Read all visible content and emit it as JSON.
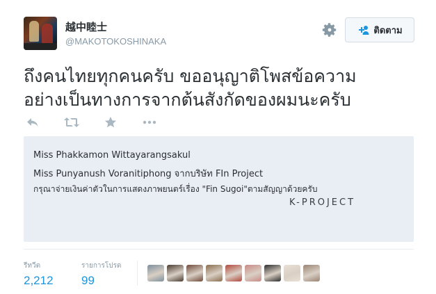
{
  "user": {
    "display_name": "越中睦士",
    "handle": "@MAKOTOKOSHINAKA"
  },
  "follow_button": {
    "label": "ติดตาม"
  },
  "tweet": {
    "line1": "ถึงคนไทยทุกคนครับ ขออนุญาติโพสข้อความ",
    "line2": "อย่างเป็นทางการจากต้นสังกัดของผมนะครับ"
  },
  "image": {
    "line1": "Miss Phakkamon Wittayarangsakul",
    "line2": "Miss Punyanush Voranitiphong จากบริษัท FIn Project",
    "line3": "กรุณาจ่ายเงินค่าตัวในการแสดงภาพยนตร์เรื่อง \"Fin Sugoi\"ตามสัญญาด้วยครับ",
    "signature": "K-PROJECT"
  },
  "stats": {
    "retweets_label": "รีทวีต",
    "retweets_value": "2,212",
    "likes_label": "รายการโปรด",
    "likes_value": "99"
  },
  "likers": [
    {
      "color": "#7c8f9c"
    },
    {
      "color": "#4a3b30"
    },
    {
      "color": "#6f4a3a"
    },
    {
      "color": "#8a6d4f"
    },
    {
      "color": "#b2483c"
    },
    {
      "color": "#c98a86"
    },
    {
      "color": "#2c2c2c"
    },
    {
      "color": "#e9e0d6"
    },
    {
      "color": "#9a8373"
    }
  ],
  "colors": {
    "link_blue": "#1b95e0",
    "muted": "#8899a6",
    "text": "#292f33",
    "image_bg": "#e9eef5"
  }
}
